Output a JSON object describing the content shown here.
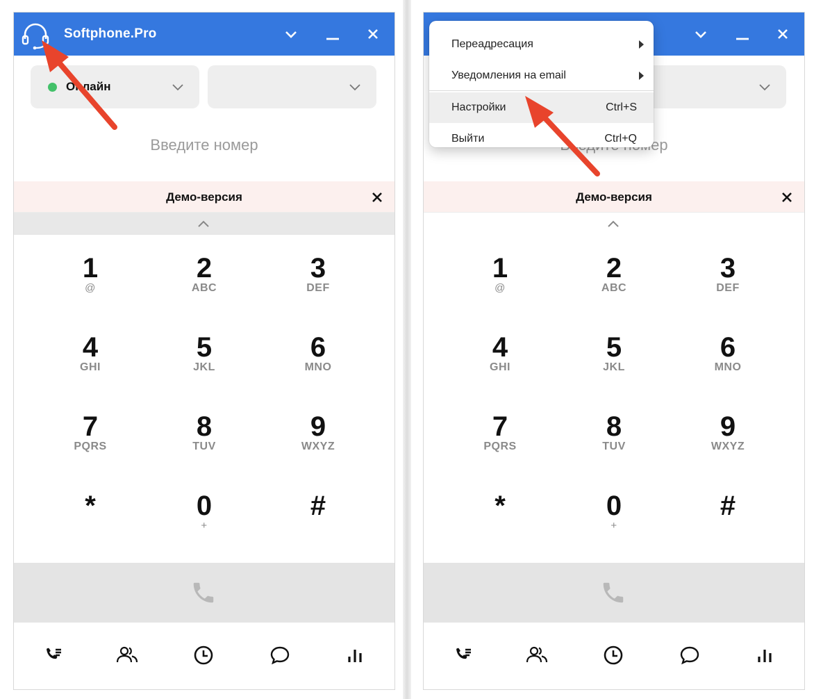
{
  "app": {
    "title": "Softphone.Pro"
  },
  "status": {
    "label": "Онлайн",
    "color": "#43c16a"
  },
  "line_select": {
    "label": ""
  },
  "number_input": {
    "placeholder": "Введите номер"
  },
  "demo_banner": {
    "text": "Демо-версия"
  },
  "keypad": [
    {
      "digit": "1",
      "letters": "@"
    },
    {
      "digit": "2",
      "letters": "ABC"
    },
    {
      "digit": "3",
      "letters": "DEF"
    },
    {
      "digit": "4",
      "letters": "GHI"
    },
    {
      "digit": "5",
      "letters": "JKL"
    },
    {
      "digit": "6",
      "letters": "MNO"
    },
    {
      "digit": "7",
      "letters": "PQRS"
    },
    {
      "digit": "8",
      "letters": "TUV"
    },
    {
      "digit": "9",
      "letters": "WXYZ"
    },
    {
      "digit": "*",
      "letters": ""
    },
    {
      "digit": "0",
      "letters": "+"
    },
    {
      "digit": "#",
      "letters": ""
    }
  ],
  "menu": {
    "items": [
      {
        "label": "Переадресация",
        "shortcut": ""
      },
      {
        "label": "Уведомления на email",
        "shortcut": ""
      },
      {
        "label": "Настройки",
        "shortcut": "Ctrl+S"
      },
      {
        "label": "Выйти",
        "shortcut": "Ctrl+Q"
      }
    ]
  },
  "nav": {
    "icons": [
      "call-log-icon",
      "contacts-icon",
      "history-icon",
      "chat-icon",
      "stats-icon"
    ]
  },
  "colors": {
    "titlebar": "#3578df",
    "online": "#43c16a",
    "demo_banner_bg": "#fcf0ee",
    "arrow": "#e8442c"
  }
}
